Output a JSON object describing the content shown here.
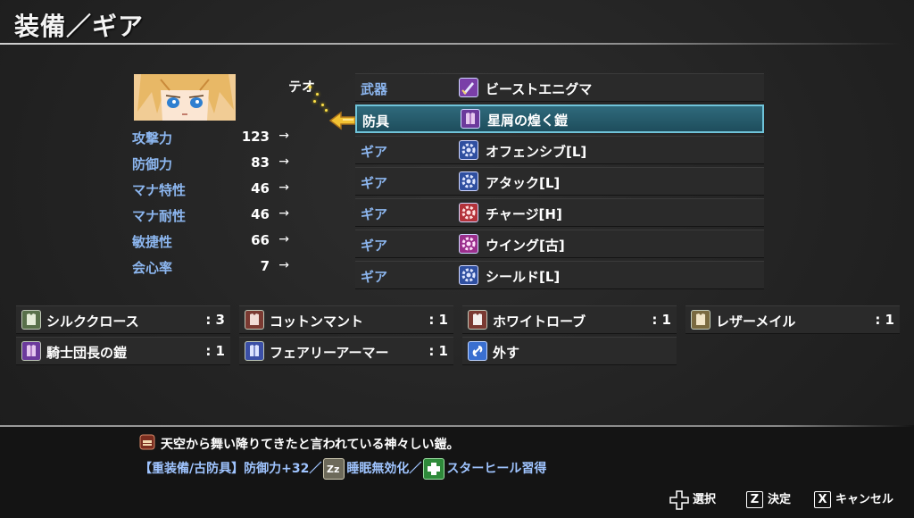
{
  "header": {
    "title": "装備／ギア"
  },
  "character": {
    "name": "テオ"
  },
  "stats": [
    {
      "label": "攻撃力",
      "value": "123",
      "arrow": "→"
    },
    {
      "label": "防御力",
      "value": "83",
      "arrow": "→"
    },
    {
      "label": "マナ特性",
      "value": "46",
      "arrow": "→"
    },
    {
      "label": "マナ耐性",
      "value": "46",
      "arrow": "→"
    },
    {
      "label": "敏捷性",
      "value": "66",
      "arrow": "→"
    },
    {
      "label": "会心率",
      "value": "7",
      "arrow": "→"
    }
  ],
  "equipment_slots": [
    {
      "slot": "武器",
      "item": "ビーストエニグマ",
      "icon": "sword-icon",
      "icon_color": "#7a3fa8"
    },
    {
      "slot": "防具",
      "item": "星屑の煌く鎧",
      "icon": "armor-icon",
      "icon_color": "#6c3a9c",
      "selected": true
    },
    {
      "slot": "ギア",
      "item": "オフェンシブ[L]",
      "icon": "gear-icon",
      "icon_color": "#2f4fa0"
    },
    {
      "slot": "ギア",
      "item": "アタック[L]",
      "icon": "gear-icon",
      "icon_color": "#2f4fa0"
    },
    {
      "slot": "ギア",
      "item": "チャージ[H]",
      "icon": "gear-icon",
      "icon_color": "#b3323a"
    },
    {
      "slot": "ギア",
      "item": "ウイング[古]",
      "icon": "gear-icon",
      "icon_color": "#9b2f8c"
    },
    {
      "slot": "ギア",
      "item": "シールド[L]",
      "icon": "gear-icon",
      "icon_color": "#2f4fa0"
    }
  ],
  "inventory": [
    {
      "name": "シルククロース",
      "count": ": 3",
      "icon": "cloth-armor-icon",
      "icon_color": "#58704a"
    },
    {
      "name": "コットンマント",
      "count": ": 1",
      "icon": "cloth-armor-icon",
      "icon_color": "#7a3a32"
    },
    {
      "name": "ホワイトローブ",
      "count": ": 1",
      "icon": "cloth-armor-icon",
      "icon_color": "#7a3a32"
    },
    {
      "name": "レザーメイル",
      "count": ": 1",
      "icon": "cloth-armor-icon",
      "icon_color": "#7a6a40"
    },
    {
      "name": "騎士団長の鎧",
      "count": ": 1",
      "icon": "armor-icon",
      "icon_color": "#6c3a9c"
    },
    {
      "name": "フェアリーアーマー",
      "count": ": 1",
      "icon": "armor-icon",
      "icon_color": "#3b4fa6"
    },
    {
      "name": "外す",
      "count": "",
      "icon": "unequip-icon",
      "icon_color": "#3a6fd0"
    }
  ],
  "description": {
    "text": "天空から舞い降りてきたと言われている神々しい鎧。",
    "effects_prefix": "【重装備/古防具】防御力+32／",
    "effect_sleep": "睡眠無効化／",
    "effect_skill": "スターヒール習得"
  },
  "controls": [
    {
      "icon": "dpad-icon",
      "label": "選択"
    },
    {
      "key": "Z",
      "label": "決定"
    },
    {
      "key": "X",
      "label": "キャンセル"
    }
  ]
}
